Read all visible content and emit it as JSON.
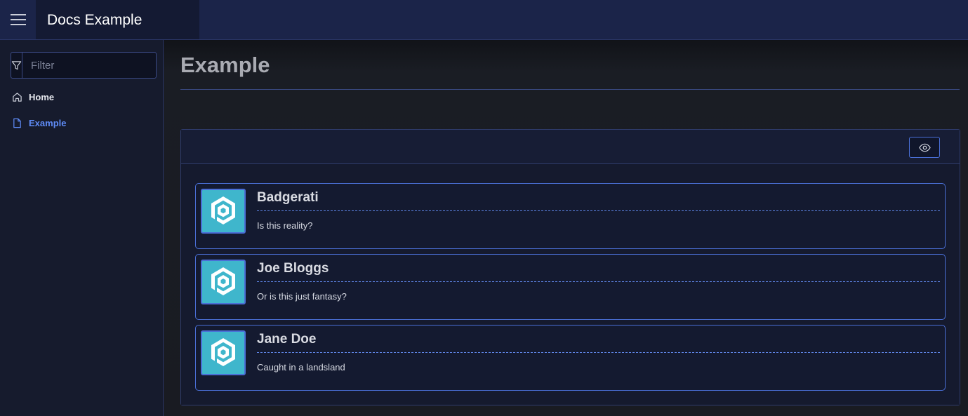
{
  "header": {
    "title": "Docs Example",
    "menu_icon": "hamburger-menu-icon"
  },
  "sidebar": {
    "filter": {
      "placeholder": "Filter",
      "value": "",
      "icon": "filter-icon"
    },
    "items": [
      {
        "label": "Home",
        "icon": "home-icon",
        "active": false
      },
      {
        "label": "Example",
        "icon": "document-icon",
        "active": true
      }
    ]
  },
  "main": {
    "title": "Example",
    "toolbar": {
      "toggle_icon": "eye-icon"
    },
    "cards": [
      {
        "name": "Badgerati",
        "text": "Is this reality?",
        "avatar_icon": "hexagon-logo-icon"
      },
      {
        "name": "Joe Bloggs",
        "text": "Or is this just fantasy?",
        "avatar_icon": "hexagon-logo-icon"
      },
      {
        "name": "Jane Doe",
        "text": "Caught in a landsland",
        "avatar_icon": "hexagon-logo-icon"
      }
    ]
  },
  "colors": {
    "accent": "#4a6fd6",
    "active_link": "#5f8cf7",
    "header_bg": "#1b2449",
    "avatar_bg": "#3fb6cc"
  }
}
